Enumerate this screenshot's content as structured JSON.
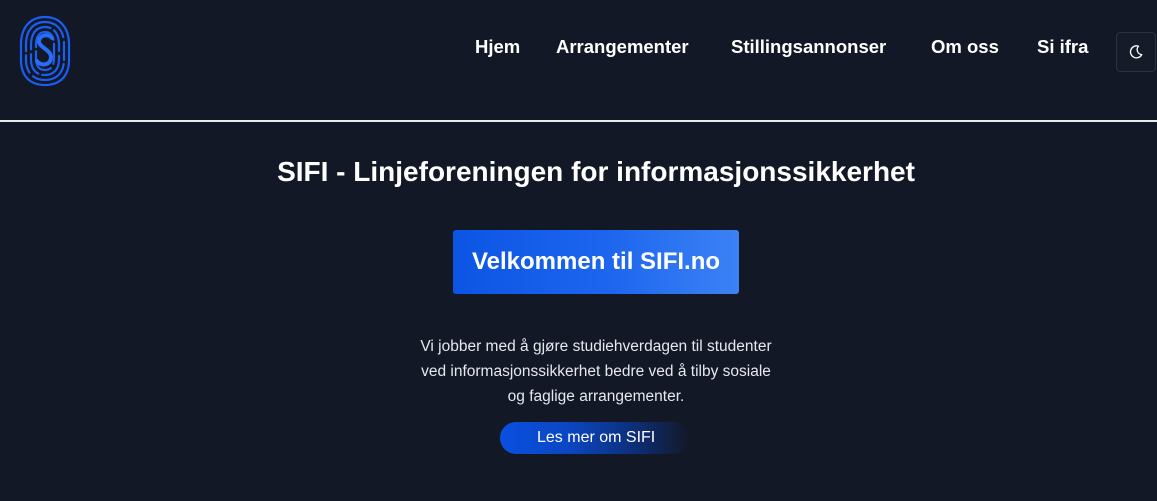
{
  "header": {
    "nav": [
      {
        "label": "Hjem"
      },
      {
        "label": "Arrangementer"
      },
      {
        "label": "Stillingsannonser"
      },
      {
        "label": "Om oss"
      },
      {
        "label": "Si ifra"
      }
    ],
    "theme_toggle_icon": "moon-icon"
  },
  "hero": {
    "title": "SIFI - Linjeforeningen for informasjonssikkerhet",
    "banner": "Velkommen til SIFI.no",
    "description_lines": [
      "Vi jobber med å gjøre studiehverdagen til studenter",
      "ved informasjonssikkerhet bedre ved å tilby sosiale",
      "og faglige arrangementer."
    ],
    "cta_label": "Les mer om SIFI"
  },
  "colors": {
    "background": "#131826",
    "accent": "#1d66ee",
    "text": "#ffffff"
  }
}
